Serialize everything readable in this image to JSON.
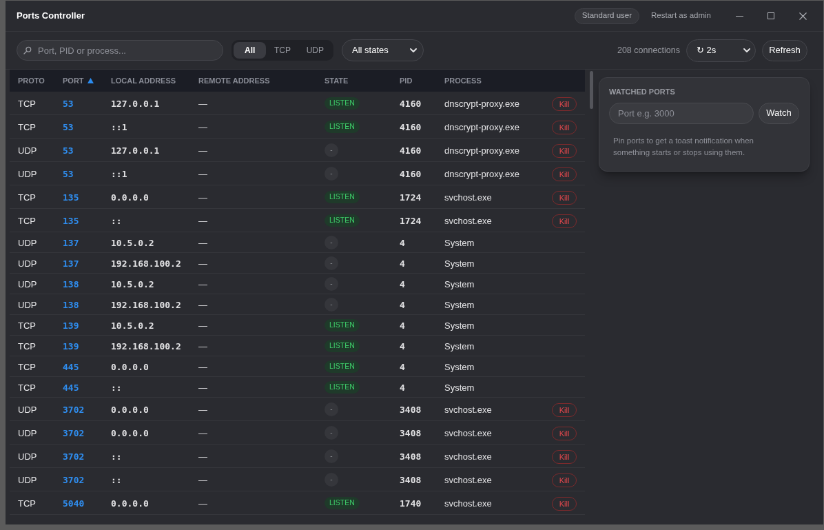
{
  "window": {
    "title": "Ports Controller",
    "user_badge": "Standard user",
    "restart_link": "Restart as admin"
  },
  "toolbar": {
    "search": {
      "placeholder": "Port, PID or process..."
    },
    "protocol_filter": [
      {
        "label": "All",
        "selected": true
      },
      {
        "label": "TCP",
        "selected": false
      },
      {
        "label": "UDP",
        "selected": false
      }
    ],
    "state_filter": {
      "value": "All states"
    },
    "connection_count": "208 connections",
    "refresh_interval": {
      "value": "↻ 2s"
    },
    "refresh_button": "Refresh"
  },
  "table": {
    "columns": [
      {
        "label": "PROTO",
        "sorted": false
      },
      {
        "label": "PORT",
        "sorted": true
      },
      {
        "label": "LOCAL ADDRESS",
        "sorted": false
      },
      {
        "label": "REMOTE ADDRESS",
        "sorted": false
      },
      {
        "label": "STATE",
        "sorted": false
      },
      {
        "label": "PID",
        "sorted": false
      },
      {
        "label": "PROCESS",
        "sorted": false
      }
    ],
    "rows": [
      {
        "proto": "TCP",
        "port": "53",
        "local": "127.0.0.1",
        "remote": "—",
        "state": {
          "label": "LISTEN",
          "kind": "listen"
        },
        "pid": "4160",
        "process": "dnscrypt-proxy.exe",
        "action": "Kill"
      },
      {
        "proto": "TCP",
        "port": "53",
        "local": "::1",
        "remote": "—",
        "state": {
          "label": "LISTEN",
          "kind": "listen"
        },
        "pid": "4160",
        "process": "dnscrypt-proxy.exe",
        "action": "Kill"
      },
      {
        "proto": "UDP",
        "port": "53",
        "local": "127.0.0.1",
        "remote": "—",
        "state": {
          "label": "-",
          "kind": "none"
        },
        "pid": "4160",
        "process": "dnscrypt-proxy.exe",
        "action": "Kill"
      },
      {
        "proto": "UDP",
        "port": "53",
        "local": "::1",
        "remote": "—",
        "state": {
          "label": "-",
          "kind": "none"
        },
        "pid": "4160",
        "process": "dnscrypt-proxy.exe",
        "action": "Kill"
      },
      {
        "proto": "TCP",
        "port": "135",
        "local": "0.0.0.0",
        "remote": "—",
        "state": {
          "label": "LISTEN",
          "kind": "listen"
        },
        "pid": "1724",
        "process": "svchost.exe",
        "action": "Kill"
      },
      {
        "proto": "TCP",
        "port": "135",
        "local": "::",
        "remote": "—",
        "state": {
          "label": "LISTEN",
          "kind": "listen"
        },
        "pid": "1724",
        "process": "svchost.exe",
        "action": "Kill"
      },
      {
        "proto": "UDP",
        "port": "137",
        "local": "10.5.0.2",
        "remote": "—",
        "state": {
          "label": "-",
          "kind": "none"
        },
        "pid": "4",
        "process": "System"
      },
      {
        "proto": "UDP",
        "port": "137",
        "local": "192.168.100.2",
        "remote": "—",
        "state": {
          "label": "-",
          "kind": "none"
        },
        "pid": "4",
        "process": "System"
      },
      {
        "proto": "UDP",
        "port": "138",
        "local": "10.5.0.2",
        "remote": "—",
        "state": {
          "label": "-",
          "kind": "none"
        },
        "pid": "4",
        "process": "System"
      },
      {
        "proto": "UDP",
        "port": "138",
        "local": "192.168.100.2",
        "remote": "—",
        "state": {
          "label": "-",
          "kind": "none"
        },
        "pid": "4",
        "process": "System"
      },
      {
        "proto": "TCP",
        "port": "139",
        "local": "10.5.0.2",
        "remote": "—",
        "state": {
          "label": "LISTEN",
          "kind": "listen"
        },
        "pid": "4",
        "process": "System"
      },
      {
        "proto": "TCP",
        "port": "139",
        "local": "192.168.100.2",
        "remote": "—",
        "state": {
          "label": "LISTEN",
          "kind": "listen"
        },
        "pid": "4",
        "process": "System"
      },
      {
        "proto": "TCP",
        "port": "445",
        "local": "0.0.0.0",
        "remote": "—",
        "state": {
          "label": "LISTEN",
          "kind": "listen"
        },
        "pid": "4",
        "process": "System"
      },
      {
        "proto": "TCP",
        "port": "445",
        "local": "::",
        "remote": "—",
        "state": {
          "label": "LISTEN",
          "kind": "listen"
        },
        "pid": "4",
        "process": "System"
      },
      {
        "proto": "UDP",
        "port": "3702",
        "local": "0.0.0.0",
        "remote": "—",
        "state": {
          "label": "-",
          "kind": "none"
        },
        "pid": "3408",
        "process": "svchost.exe",
        "action": "Kill"
      },
      {
        "proto": "UDP",
        "port": "3702",
        "local": "0.0.0.0",
        "remote": "—",
        "state": {
          "label": "-",
          "kind": "none"
        },
        "pid": "3408",
        "process": "svchost.exe",
        "action": "Kill"
      },
      {
        "proto": "UDP",
        "port": "3702",
        "local": "::",
        "remote": "—",
        "state": {
          "label": "-",
          "kind": "none"
        },
        "pid": "3408",
        "process": "svchost.exe",
        "action": "Kill"
      },
      {
        "proto": "UDP",
        "port": "3702",
        "local": "::",
        "remote": "—",
        "state": {
          "label": "-",
          "kind": "none"
        },
        "pid": "3408",
        "process": "svchost.exe",
        "action": "Kill"
      },
      {
        "proto": "TCP",
        "port": "5040",
        "local": "0.0.0.0",
        "remote": "—",
        "state": {
          "label": "LISTEN",
          "kind": "listen"
        },
        "pid": "1740",
        "process": "svchost.exe",
        "action": "Kill"
      }
    ]
  },
  "watched_ports": {
    "title": "WATCHED PORTS",
    "input": {
      "placeholder": "Port e.g. 3000"
    },
    "button": "Watch",
    "hint": "Pin ports to get a toast notification when something starts or stops using them."
  }
}
